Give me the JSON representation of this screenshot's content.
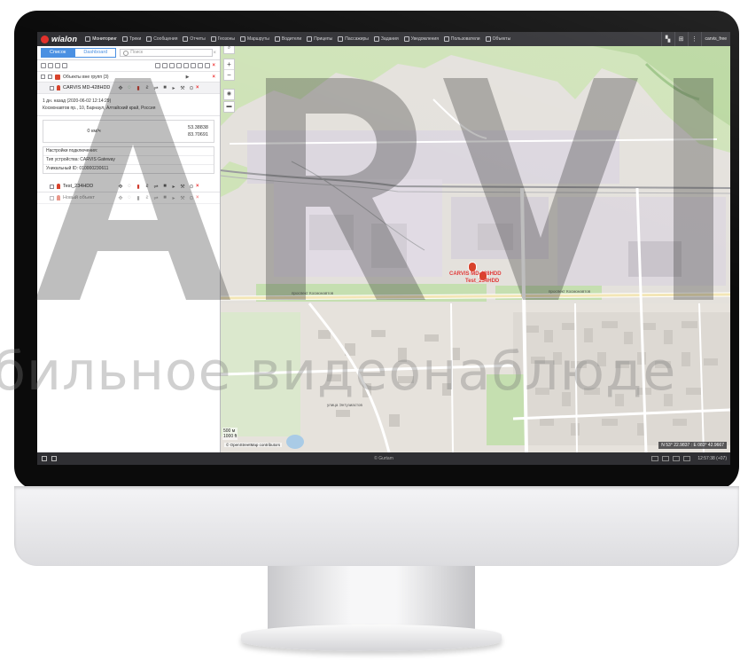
{
  "topbar": {
    "logo": "wialon",
    "nav": [
      {
        "label": "Мониторинг",
        "icon": "globe-icon"
      },
      {
        "label": "Треки",
        "icon": "track-icon"
      },
      {
        "label": "Сообщения",
        "icon": "messages-icon"
      },
      {
        "label": "Отчеты",
        "icon": "reports-icon"
      },
      {
        "label": "Геозоны",
        "icon": "geofence-icon"
      },
      {
        "label": "Маршруты",
        "icon": "routes-icon"
      },
      {
        "label": "Водители",
        "icon": "drivers-icon"
      },
      {
        "label": "Прицепы",
        "icon": "trailers-icon"
      },
      {
        "label": "Пассажиры",
        "icon": "passengers-icon"
      },
      {
        "label": "Задания",
        "icon": "tasks-icon"
      },
      {
        "label": "Уведомления",
        "icon": "notifications-icon"
      },
      {
        "label": "Пользователи",
        "icon": "users-icon"
      },
      {
        "label": "Объекты",
        "icon": "units-icon"
      }
    ],
    "user": "carvis_free"
  },
  "panel": {
    "tab_list": "Список",
    "tab_dashboard": "Dashboard",
    "search_placeholder": "Поиск",
    "group_label": "Объекты вне групп (3)",
    "units": [
      {
        "name": "CARVIS MD-428HDD"
      },
      {
        "name": "Test_234HDD"
      },
      {
        "name": "Новый объект"
      }
    ],
    "info_time": "1 дн. назад (2020-06-02 12:14:29)",
    "info_address": "Космонавтов пр., 10, Барнаул, Алтайский край, Россия",
    "speed": "0 км/ч",
    "lat": "53.38838",
    "lon": "83.70691",
    "conn_title": "Настройки подключения:",
    "device_type": "Тип устройства: CARVIS Gateway",
    "unique_id": "Уникальный ID: 010000230611"
  },
  "map": {
    "object_label_1": "CARVIS MD-428HDD",
    "object_label_2": "Test_234HDD",
    "street_main": "проспект Космонавтов",
    "street_side": "улица Энтузиастов",
    "scale_top": "500 м",
    "scale_bottom": "1000 ft",
    "attribution": "© OpenStreetMap contributors",
    "coordinates": "N 53° 22.9837 : E 083° 42.9667"
  },
  "bottombar": {
    "copyright": "© Gurtam",
    "time": "12:57:38 (+07)"
  },
  "watermark": {
    "letters": "ARVI",
    "text": "бильное видеонаблюде"
  },
  "colors": {
    "accent": "#4a90e2",
    "topbar": "#2f2f33",
    "marker": "#d8432c"
  }
}
